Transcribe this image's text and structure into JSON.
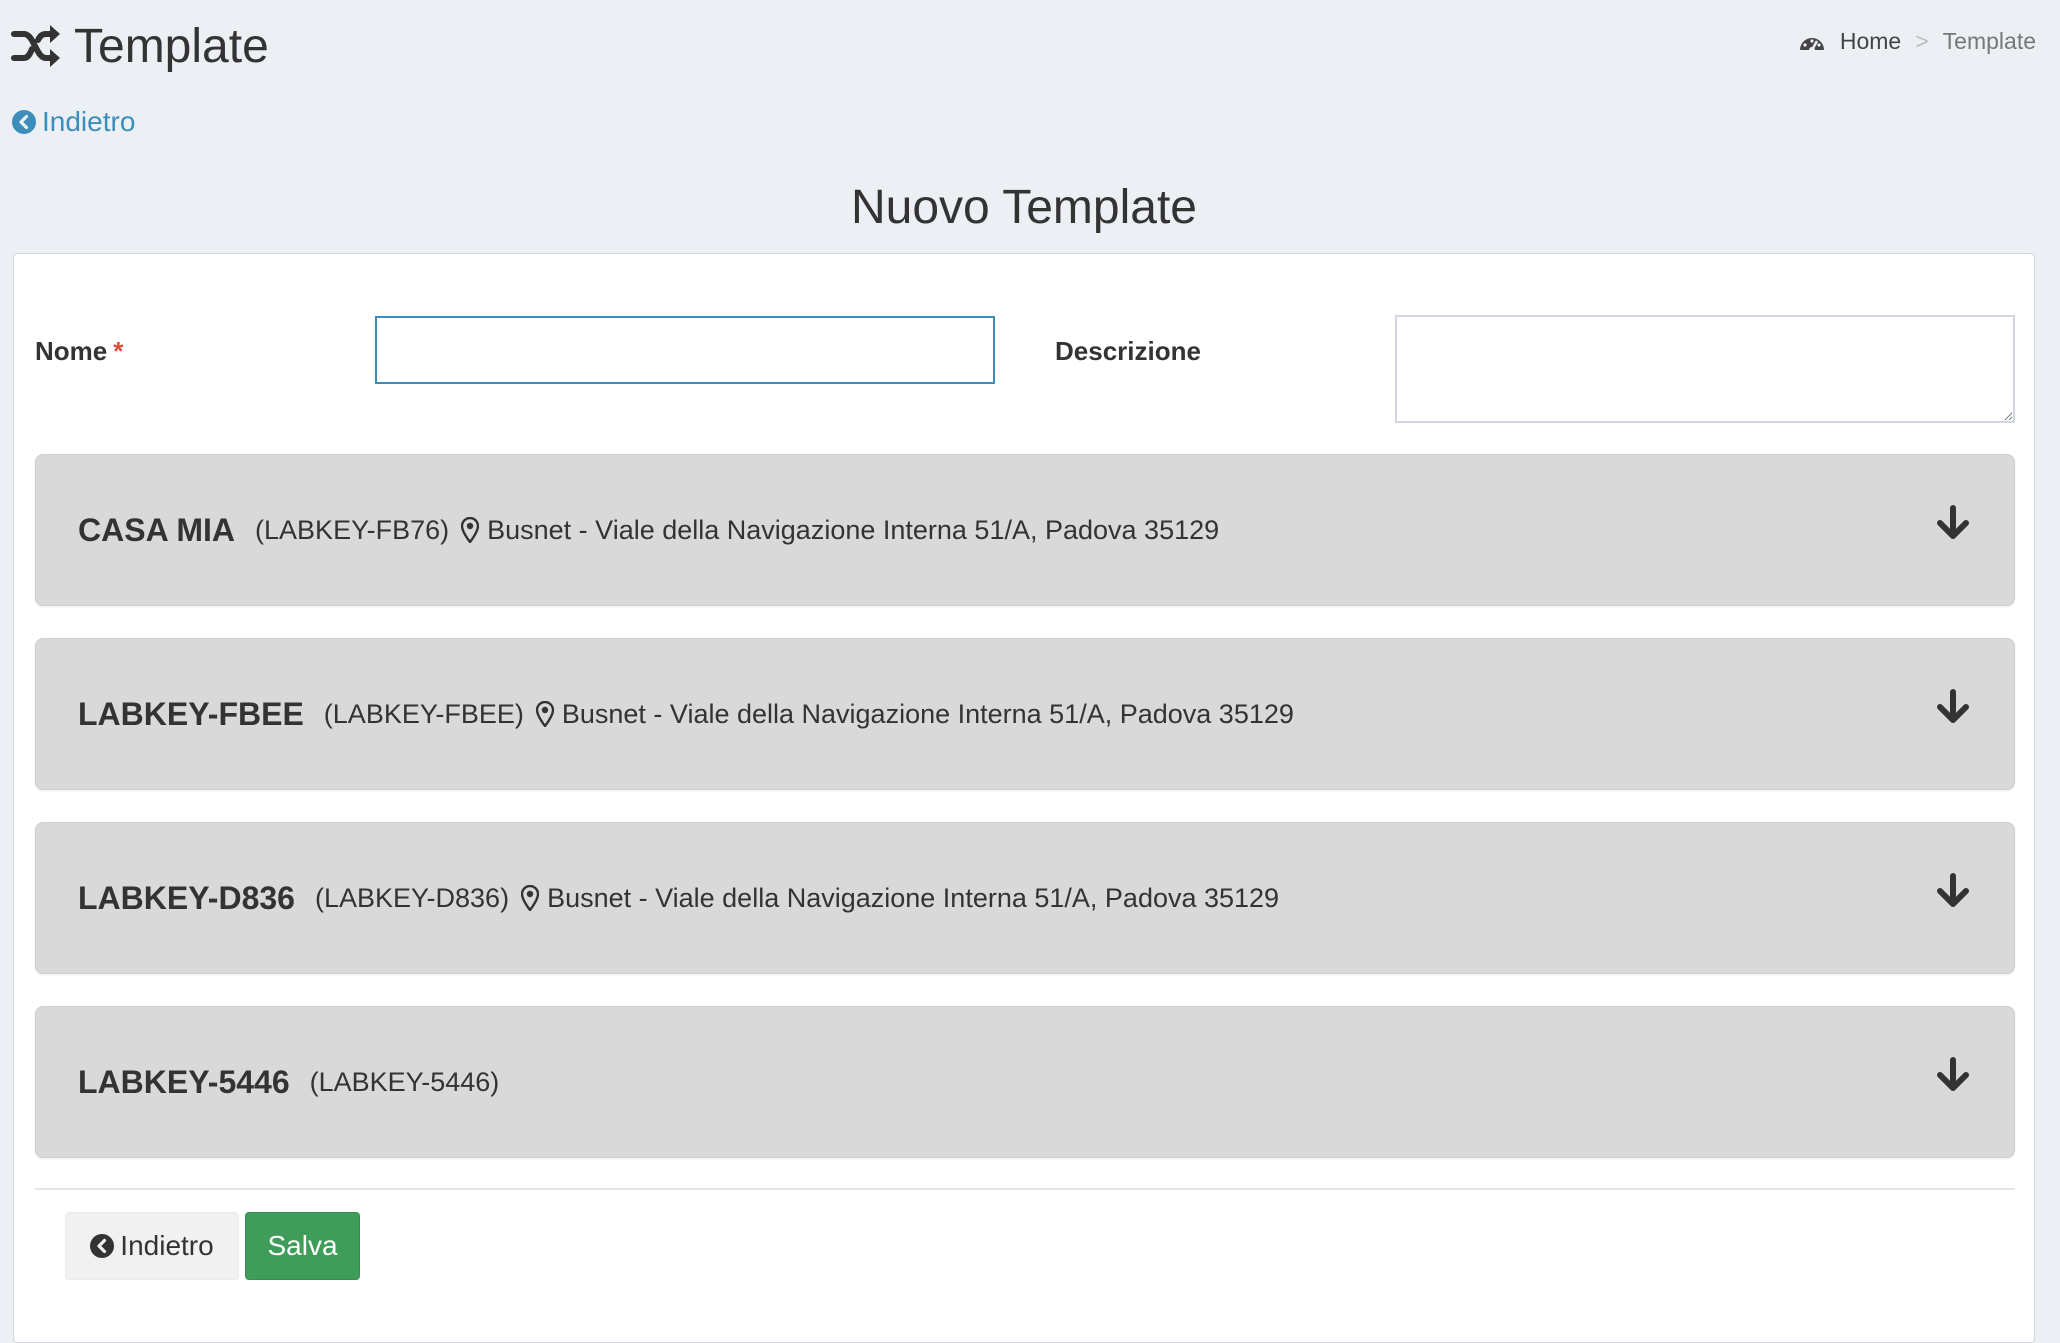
{
  "header": {
    "title": "Template",
    "icon": "shuffle-icon"
  },
  "breadcrumb": {
    "home": "Home",
    "separator": ">",
    "current": "Template"
  },
  "back_link": "Indietro",
  "form": {
    "title": "Nuovo Template",
    "name_label": "Nome",
    "required_mark": "*",
    "name_value": "",
    "description_label": "Descrizione",
    "description_value": ""
  },
  "devices": [
    {
      "name": "CASA MIA",
      "code": "(LABKEY-FB76)",
      "address": "Busnet - Viale della Navigazione Interna 51/A, Padova 35129"
    },
    {
      "name": "LABKEY-FBEE",
      "code": "(LABKEY-FBEE)",
      "address": "Busnet - Viale della Navigazione Interna 51/A, Padova 35129"
    },
    {
      "name": "LABKEY-D836",
      "code": "(LABKEY-D836)",
      "address": "Busnet - Viale della Navigazione Interna 51/A, Padova 35129"
    },
    {
      "name": "LABKEY-5446",
      "code": "(LABKEY-5446)",
      "address": ""
    }
  ],
  "footer": {
    "back_label": "Indietro",
    "save_label": "Salva"
  },
  "colors": {
    "background": "#ecf0f5",
    "link": "#3c8dbc",
    "save": "#3f9d5a",
    "panel": "#d9d9d9",
    "required": "#dd4b39"
  }
}
